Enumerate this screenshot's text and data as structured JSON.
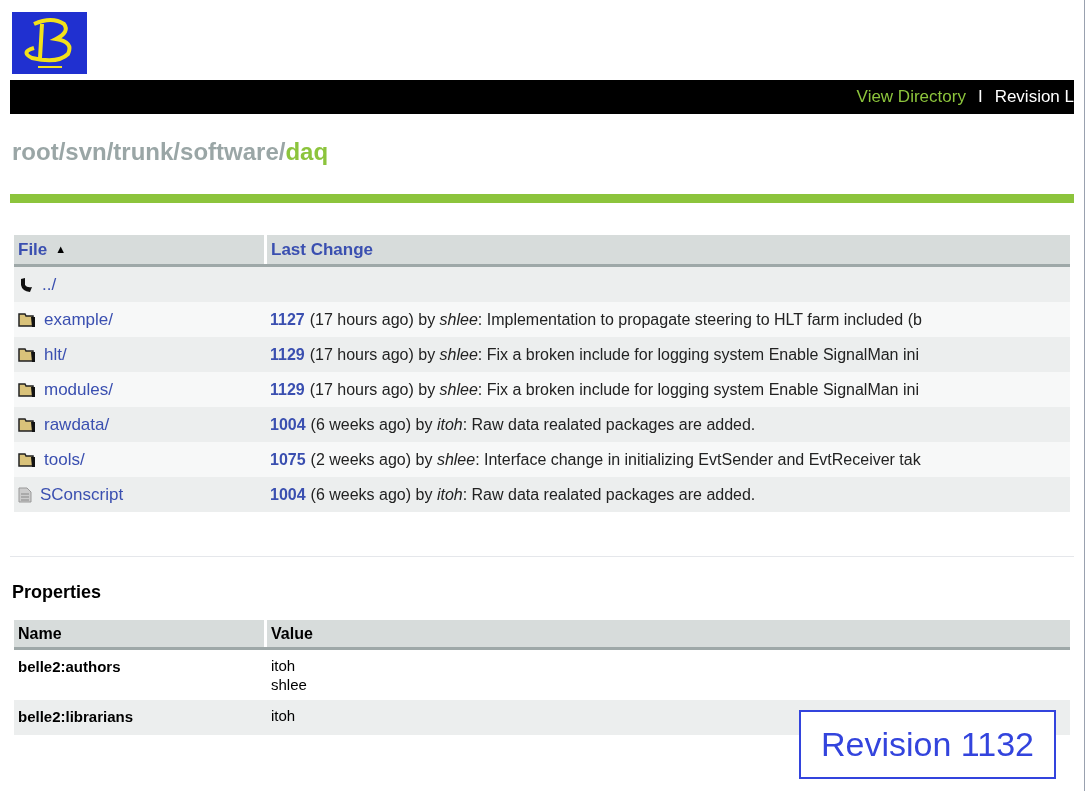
{
  "nav": {
    "links": [
      {
        "label": "View Directory",
        "selected": false
      },
      {
        "label": "Revision L",
        "selected": true
      }
    ],
    "separator": "I"
  },
  "breadcrumb": {
    "parts": [
      "root/",
      "svn/",
      "trunk/",
      "software/"
    ],
    "current": "daq"
  },
  "files": {
    "columns": [
      {
        "label": "File",
        "sort": "▲"
      },
      {
        "label": "Last Change"
      }
    ],
    "rows": [
      {
        "kind": "parent",
        "name": "../"
      },
      {
        "kind": "folder",
        "name": "example/",
        "revision": "1127",
        "change": "(17 hours ago) by *shlee*: Implementation to propagate steering to HLT farm included (b"
      },
      {
        "kind": "folder",
        "name": "hlt/",
        "revision": "1129",
        "change": "(17 hours ago) by *shlee*: Fix a broken include for logging system Enable SignalMan ini"
      },
      {
        "kind": "folder",
        "name": "modules/",
        "revision": "1129",
        "change": "(17 hours ago) by *shlee*: Fix a broken include for logging system Enable SignalMan ini"
      },
      {
        "kind": "folder",
        "name": "rawdata/",
        "revision": "1004",
        "change": "(6 weeks ago) by *itoh*: Raw data realated packages are added."
      },
      {
        "kind": "folder",
        "name": "tools/",
        "revision": "1075",
        "change": "(2 weeks ago) by *shlee*: Interface change in initializing EvtSender and EvtReceiver tak"
      },
      {
        "kind": "file",
        "name": "SConscript",
        "revision": "1004",
        "change": "(6 weeks ago) by *itoh*: Raw data realated packages are added."
      }
    ]
  },
  "properties": {
    "title": "Properties",
    "columns": [
      "Name",
      "Value"
    ],
    "rows": [
      {
        "name": "belle2:authors",
        "values": [
          "itoh",
          "shlee"
        ]
      },
      {
        "name": "belle2:librarians",
        "values": [
          "itoh"
        ]
      }
    ]
  },
  "revision_label": "Revision 1132"
}
